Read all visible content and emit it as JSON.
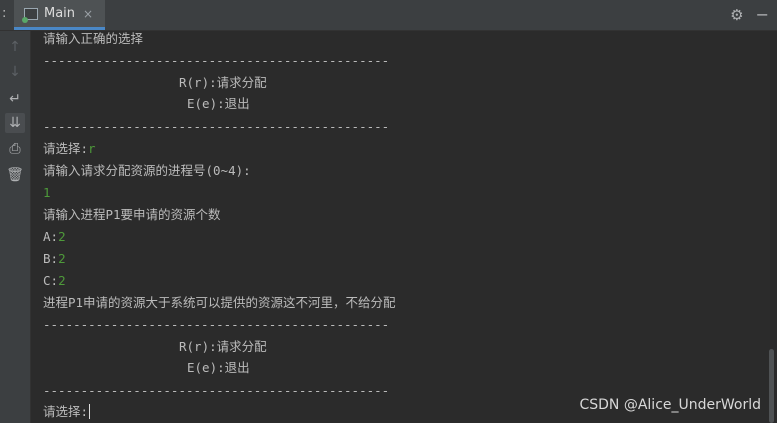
{
  "tabbar": {
    "left_marker": ":",
    "tab_label": "Main",
    "close_glyph": "×",
    "gear_glyph": "⚙",
    "hide_glyph": "−"
  },
  "toolbar": {
    "up": "↑",
    "down": "↓",
    "wrap": "↵",
    "scroll_end": "⇊",
    "print": "⎙",
    "trash": "🗑"
  },
  "console": {
    "l1": "请输入正确的选择",
    "sep": "----------------------------------------------",
    "menu_r": "R(r):请求分配",
    "menu_e": "E(e):退出",
    "choose_label": "请选择:",
    "choose_value": "r",
    "ask_pid": "请输入请求分配资源的进程号(0~4):",
    "pid_value": "1",
    "ask_res": "请输入进程P1要申请的资源个数",
    "a_label": "A:",
    "a_value": "2",
    "b_label": "B:",
    "b_value": "2",
    "c_label": "C:",
    "c_value": "2",
    "result": "进程P1申请的资源大于系统可以提供的资源这不河里，不给分配",
    "choose2_label": "请选择:"
  },
  "watermark": "CSDN @Alice_UnderWorld"
}
